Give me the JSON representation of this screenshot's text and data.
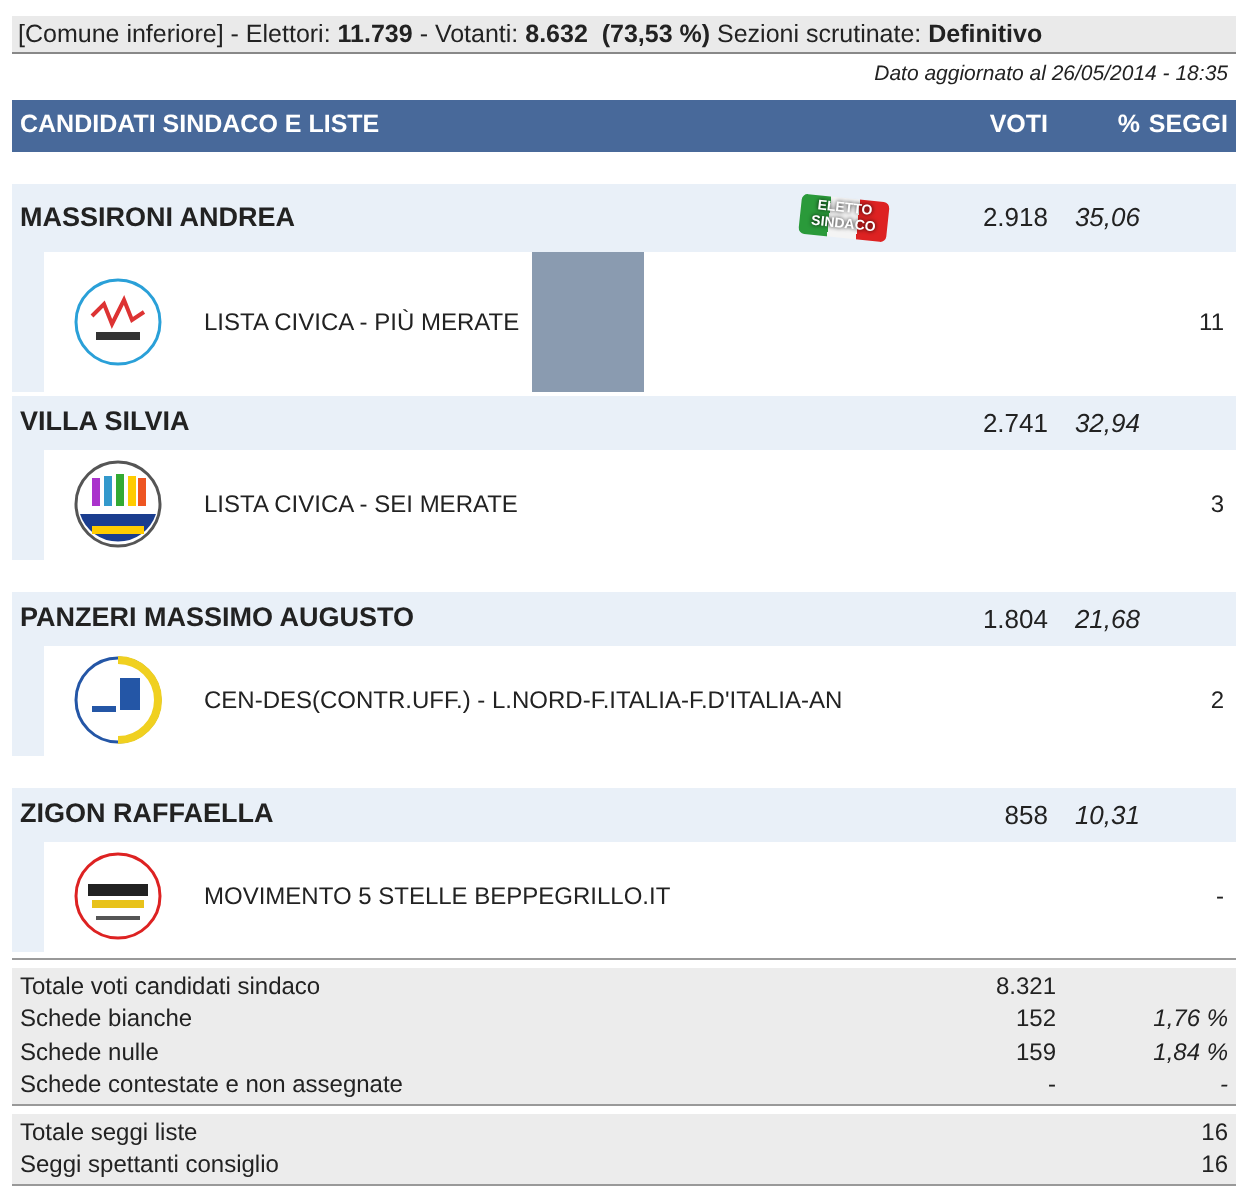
{
  "summary": {
    "parts": [
      {
        "text": "[Comune inferiore] - Elettori: ",
        "bold": false
      },
      {
        "text": "11.739",
        "bold": true
      },
      {
        "text": " - Votanti: ",
        "bold": false
      },
      {
        "text": "8.632",
        "bold": true
      },
      {
        "text": "  (73,53 %)",
        "bold": true
      },
      {
        "text": " Sezioni scrutinate: ",
        "bold": false
      },
      {
        "text": "Definitivo",
        "bold": true
      }
    ]
  },
  "updated": "Dato aggiornato al 26/05/2014 - 18:35",
  "columns": [
    "CANDIDATI SINDACO E LISTE",
    "VOTI",
    "%",
    "SEGGI"
  ],
  "candidates": [
    {
      "name": "MASSIRONI ANDREA",
      "votes": "2.918",
      "percent": "35,06",
      "elected": true,
      "badge": "ELETTO SINDACO",
      "photo": true,
      "lists": [
        {
          "name": "LISTA CIVICA - PIÙ MERATE",
          "seats": "11",
          "kind": "civica-piu"
        }
      ]
    },
    {
      "name": "VILLA SILVIA",
      "votes": "2.741",
      "percent": "32,94",
      "elected": false,
      "photo": false,
      "lists": [
        {
          "name": "LISTA CIVICA - SEI MERATE",
          "seats": "3",
          "kind": "sei"
        }
      ]
    },
    {
      "name": "PANZERI MASSIMO AUGUSTO",
      "votes": "1.804",
      "percent": "21,68",
      "elected": false,
      "photo": false,
      "lists": [
        {
          "name": "CEN-DES(CONTR.UFF.) - L.NORD-F.ITALIA-F.D'ITALIA-AN",
          "seats": "2",
          "kind": "cendes"
        }
      ]
    },
    {
      "name": "ZIGON RAFFAELLA",
      "votes": "858",
      "percent": "10,31",
      "elected": false,
      "photo": false,
      "lists": [
        {
          "name": "MOVIMENTO 5 STELLE BEPPEGRILLO.IT",
          "seats": "-",
          "kind": "m5s"
        }
      ]
    }
  ],
  "totals": [
    {
      "label": "Totale voti candidati sindaco",
      "votes": "8.321"
    },
    {
      "label": "Schede bianche",
      "votes": "152",
      "percent": "1,76 %"
    },
    {
      "label": "Schede nulle",
      "votes": "159",
      "percent": "1,84 %"
    },
    {
      "label": "Schede contestate e non assegnate",
      "votes": "-",
      "percent": "-"
    }
  ],
  "seats": [
    {
      "label": "Totale seggi liste",
      "value": "16"
    },
    {
      "label": "Seggi spettanti consiglio",
      "value": "16"
    }
  ]
}
